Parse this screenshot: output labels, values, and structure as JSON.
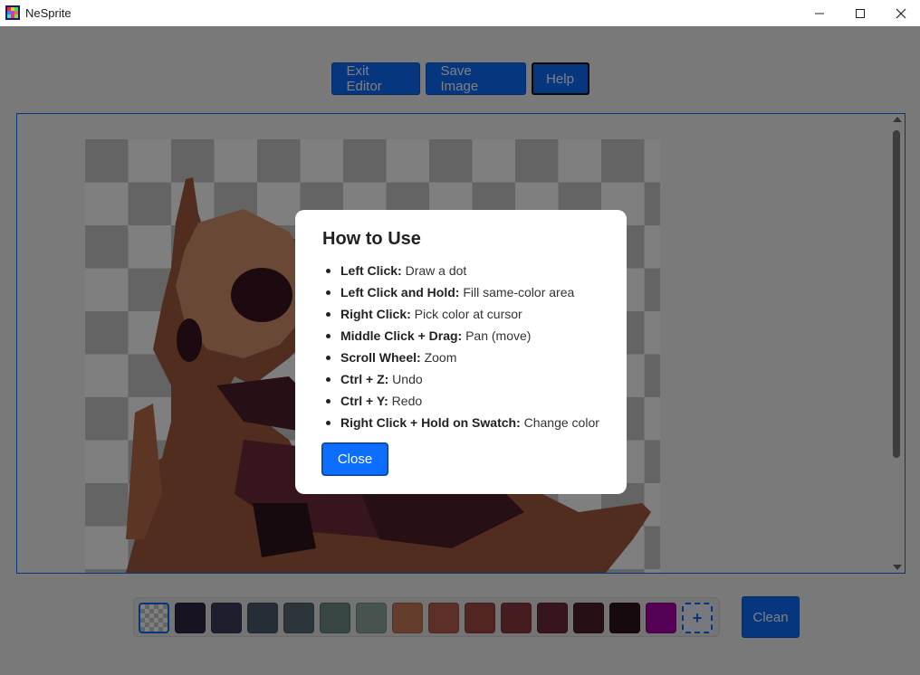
{
  "window": {
    "title": "NeSprite",
    "app_icon": "nesprite-logo-icon",
    "controls": [
      "minimize-icon",
      "maximize-icon",
      "close-icon"
    ]
  },
  "toolbar": {
    "exit_label": "Exit Editor",
    "save_label": "Save Image",
    "help_label": "Help"
  },
  "palette": {
    "swatches": [
      "transparent",
      "#2e2745",
      "#3a3e5e",
      "#4a5a6e",
      "#566a74",
      "#6e8a86",
      "#8fa69e",
      "#c87a5a",
      "#b85e52",
      "#a04a44",
      "#8a3a40",
      "#6e2a3a",
      "#4e1e2c",
      "#2e141c",
      "#a800a8"
    ],
    "add_label": "+",
    "clean_label": "Clean"
  },
  "help_modal": {
    "title": "How to Use",
    "items": [
      {
        "key": "Left Click:",
        "desc": "Draw a dot"
      },
      {
        "key": "Left Click and Hold:",
        "desc": "Fill same-color area"
      },
      {
        "key": "Right Click:",
        "desc": "Pick color at cursor"
      },
      {
        "key": "Middle Click + Drag:",
        "desc": "Pan (move)"
      },
      {
        "key": "Scroll Wheel:",
        "desc": "Zoom"
      },
      {
        "key": "Ctrl + Z:",
        "desc": "Undo"
      },
      {
        "key": "Ctrl + Y:",
        "desc": "Redo"
      },
      {
        "key": "Right Click + Hold on Swatch:",
        "desc": "Change color"
      }
    ],
    "close_label": "Close"
  },
  "colors": {
    "accent": "#0d6efd",
    "overlay": "rgba(0,0,0,0.5)"
  }
}
